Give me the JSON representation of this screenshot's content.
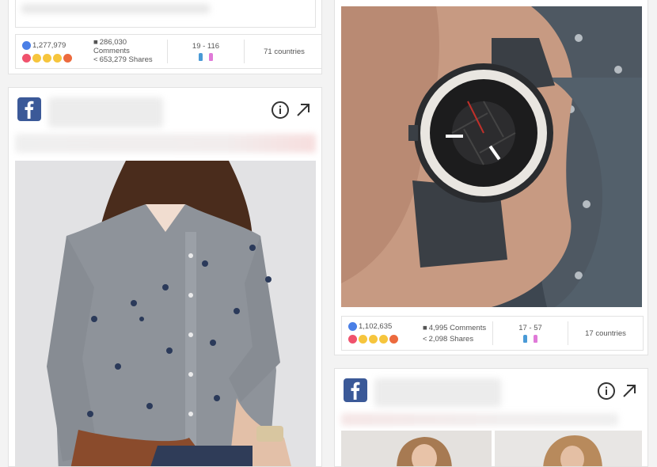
{
  "cards": {
    "top_left": {
      "likes": "1,277,979",
      "comments_count": "286,030",
      "comments_label": "Comments",
      "shares": "653,279 Shares",
      "age_range": "19 - 116",
      "countries": "71 countries"
    },
    "watch": {
      "likes": "1,102,635",
      "comments": "4,995 Comments",
      "shares": "2,098 Shares",
      "age_range": "17 - 57",
      "countries": "17 countries"
    }
  },
  "icons": {
    "platform": "facebook-icon",
    "info": "info-icon",
    "open": "arrow-up-right-icon",
    "comments": "speech-bubble-icon",
    "shares": "share-icon",
    "reactions": [
      "like",
      "love",
      "haha",
      "wow",
      "sad",
      "angry"
    ],
    "gender": [
      "male-icon",
      "female-icon"
    ]
  },
  "colors": {
    "facebook": "#3b5998",
    "like": "#4a7fe6",
    "love": "#f0526d",
    "male": "#4a9ad6",
    "female": "#e07ad8"
  }
}
